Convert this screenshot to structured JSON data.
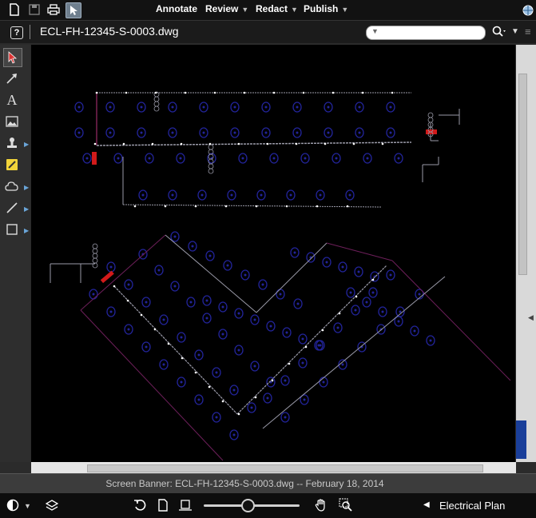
{
  "toolbar": {
    "menus": [
      {
        "label": "Annotate",
        "has_dropdown": false
      },
      {
        "label": "Review",
        "has_dropdown": true
      },
      {
        "label": "Redact",
        "has_dropdown": true
      },
      {
        "label": "Publish",
        "has_dropdown": true
      }
    ],
    "icons": [
      "new-document-icon",
      "save-icon",
      "print-icon",
      "select-pointer-icon"
    ]
  },
  "document": {
    "title": "ECL-FH-12345-S-0003.dwg",
    "search_placeholder": ""
  },
  "tools": [
    "select-annotation-icon",
    "arrow-tool-icon",
    "text-tool-icon",
    "image-stamp-icon",
    "stamp-icon",
    "highlighter-icon",
    "cloud-shape-icon",
    "line-tool-icon",
    "rectangle-tool-icon"
  ],
  "banner": {
    "text": "Screen Banner: ECL-FH-12345-S-0003.dwg -- February 18, 2014"
  },
  "bottom": {
    "layout_name": "Electrical Plan",
    "zoom_level": 0.45
  },
  "colors": {
    "accent": "#6aa5d8",
    "drawing_background": "#000000",
    "fixture_blue": "#22249a",
    "wire_gray": "#9a9aa8",
    "device_red": "#d11a1a"
  }
}
